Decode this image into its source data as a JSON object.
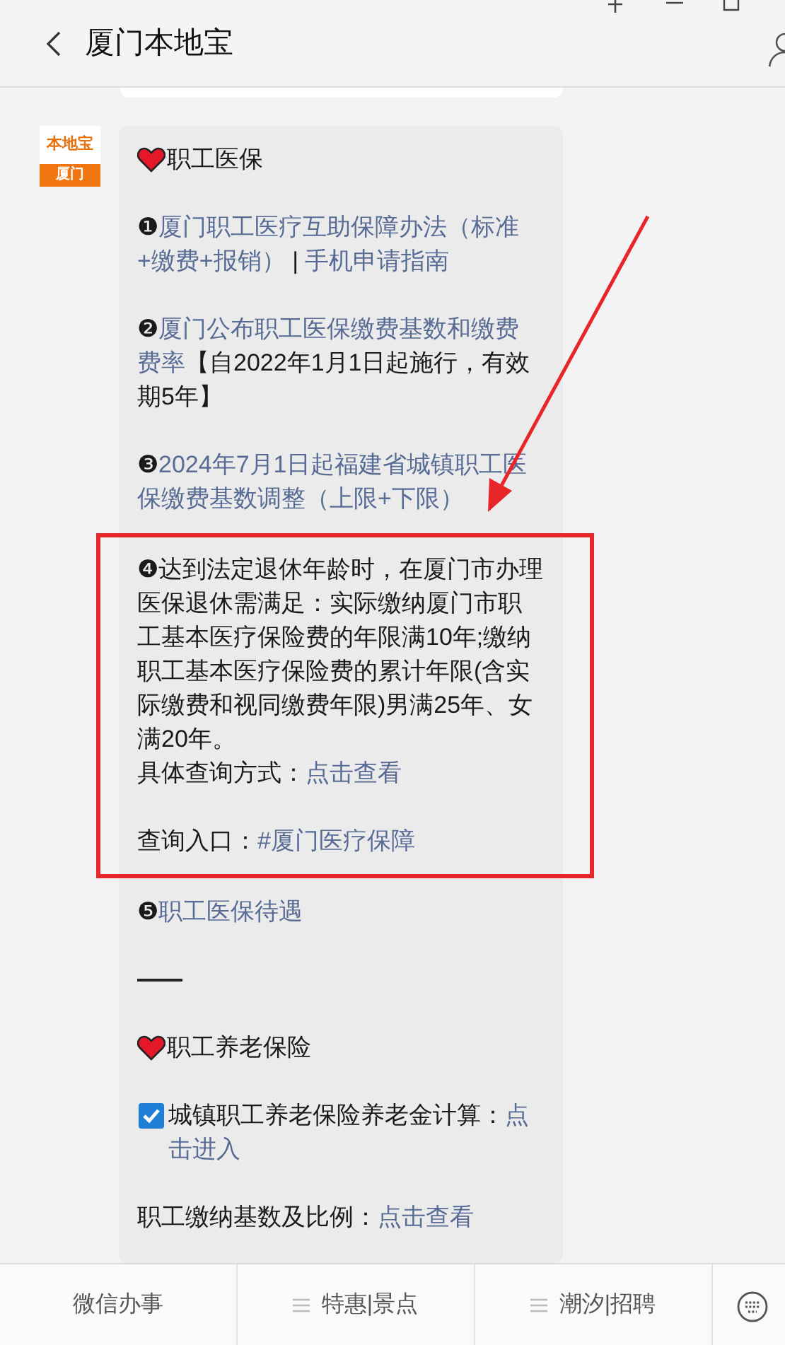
{
  "header": {
    "title": "厦门本地宝"
  },
  "avatar": {
    "top": "本地宝",
    "bottom": "厦门"
  },
  "message": {
    "paragraphs": [
      {
        "highlighted": false,
        "lines": [
          [
            {
              "kind": "heart"
            },
            {
              "kind": "text",
              "text": "职工医保"
            }
          ]
        ]
      },
      {
        "highlighted": false,
        "lines": [
          [
            {
              "kind": "text",
              "text": "❶"
            },
            {
              "kind": "link",
              "text": "厦门职工医疗互助保障办法（标准+缴费+报销）"
            },
            {
              "kind": "text",
              "text": " | "
            },
            {
              "kind": "link",
              "text": "手机申请指南"
            }
          ]
        ]
      },
      {
        "highlighted": false,
        "lines": [
          [
            {
              "kind": "text",
              "text": "❷"
            },
            {
              "kind": "link",
              "text": "厦门公布职工医保缴费基数和缴费费率"
            },
            {
              "kind": "text",
              "text": "【自2022年1月1日起施行，有效期5年】"
            }
          ]
        ]
      },
      {
        "highlighted": false,
        "lines": [
          [
            {
              "kind": "text",
              "text": "❸"
            },
            {
              "kind": "link",
              "text": "2024年7月1日起福建省城镇职工医保缴费基数调整（上限+下限）"
            }
          ]
        ]
      },
      {
        "highlighted": true,
        "lines": [
          [
            {
              "kind": "text",
              "text": "❹达到法定退休年龄时，在厦门市办理医保退休需满足：实际缴纳厦门市职工基本医疗保险费的年限满10年;缴纳职工基本医疗保险费的累计年限(含实际缴费和视同缴费年限)男满25年、女满20年。"
            }
          ],
          [
            {
              "kind": "text",
              "text": "具体查询方式："
            },
            {
              "kind": "link",
              "text": "点击查看"
            }
          ],
          [
            {
              "kind": "gap"
            },
            {
              "kind": "text",
              "text": "查询入口："
            },
            {
              "kind": "link",
              "text": "#厦门医疗保障"
            }
          ]
        ]
      },
      {
        "highlighted": false,
        "lines": [
          [
            {
              "kind": "text",
              "text": "❺"
            },
            {
              "kind": "link",
              "text": "职工医保待遇"
            }
          ]
        ]
      },
      {
        "highlighted": false,
        "lines": [
          [
            {
              "kind": "rule"
            }
          ]
        ]
      },
      {
        "highlighted": false,
        "lines": [
          [
            {
              "kind": "heart"
            },
            {
              "kind": "text",
              "text": "职工养老保险"
            }
          ]
        ]
      },
      {
        "highlighted": false,
        "lines": [
          [
            {
              "kind": "check"
            },
            {
              "kind": "text",
              "text": "城镇职工养老保险养老金计算："
            },
            {
              "kind": "link",
              "text": "点击进入"
            }
          ]
        ]
      },
      {
        "highlighted": false,
        "lines": [
          [
            {
              "kind": "text",
              "text": "职工缴纳基数及比例："
            },
            {
              "kind": "link",
              "text": "点击查看"
            }
          ]
        ]
      }
    ]
  },
  "menu": [
    {
      "label": "微信办事",
      "has_submenu": false
    },
    {
      "label": "特惠|景点",
      "has_submenu": true
    },
    {
      "label": "潮汐|招聘",
      "has_submenu": true
    }
  ]
}
